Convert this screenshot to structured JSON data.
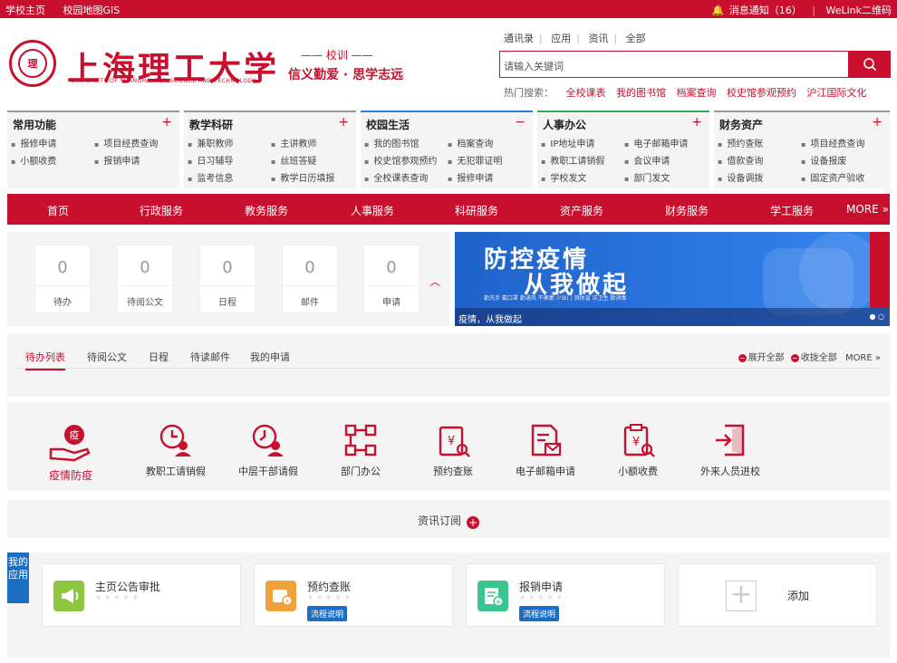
{
  "topbar": {
    "left": [
      "学校主页",
      "校园地图GIS"
    ],
    "notice": "消息通知（16）",
    "welink": "WeLink二维码"
  },
  "logo": {
    "cn": "上海理工大学",
    "en": "UNIVERSITY OF SHANGHAI FOR SCIENCE AND TECHNOLOGY"
  },
  "motto": {
    "title": "—— 校训 ——",
    "text": "信义勤爱 · 思学志远"
  },
  "top_nav": [
    "通讯录",
    "应用",
    "资讯",
    "全部"
  ],
  "search": {
    "placeholder": "请输入关键词"
  },
  "hot": {
    "label": "热门搜索：",
    "keywords": [
      "全校课表",
      "我的图书馆",
      "档案查询",
      "校史馆参观预约",
      "沪江国际文化"
    ]
  },
  "quick": [
    {
      "title": "常用功能",
      "toggle": "+",
      "color": "#999999",
      "items": [
        "报修申请",
        "项目经费查询",
        "小额收费",
        "报销申请"
      ]
    },
    {
      "title": "教学科研",
      "toggle": "+",
      "color": "#999999",
      "items": [
        "兼职教师",
        "主讲教师",
        "日习辅导",
        "丝班答疑",
        "监考信息",
        "教学日历填报"
      ]
    },
    {
      "title": "校园生活",
      "toggle": "−",
      "color": "#2a7ad6",
      "items": [
        "我的图书馆",
        "档案查询",
        "校史馆参观预约",
        "无犯罪证明",
        "全校课表查询",
        "报修申请"
      ]
    },
    {
      "title": "人事办公",
      "toggle": "+",
      "color": "#36a75a",
      "items": [
        "IP地址申请",
        "电子邮箱申请",
        "教职工请销假",
        "会议申请",
        "学校发文",
        "部门发文"
      ]
    },
    {
      "title": "财务资产",
      "toggle": "+",
      "color": "#999999",
      "items": [
        "预约查账",
        "项目经费查询",
        "借款查询",
        "设备报废",
        "设备调拨",
        "固定资产验收"
      ]
    }
  ],
  "main_nav": [
    "首页",
    "行政服务",
    "教务服务",
    "人事服务",
    "科研服务",
    "资产服务",
    "财务服务",
    "学工服务",
    "MORE »"
  ],
  "stats": [
    {
      "value": "0",
      "label": "待办"
    },
    {
      "value": "0",
      "label": "待阅公文"
    },
    {
      "value": "0",
      "label": "日程"
    },
    {
      "value": "0",
      "label": "邮件"
    },
    {
      "value": "0",
      "label": "申请"
    }
  ],
  "banner": {
    "line1": "防控疫情",
    "line2": "从我做起",
    "small": "勤洗手 戴口罩 勤通风 不聚集 少出门 测体温 讲卫生 勤消毒",
    "caption": "疫情，从我做起"
  },
  "tabs": {
    "items": [
      "待办列表",
      "待阅公文",
      "日程",
      "待读邮件",
      "我的申请"
    ],
    "expand": "展开全部",
    "collapse": "收拢全部",
    "more": "MORE »"
  },
  "apps": [
    "疫情防疫",
    "教职工请销假",
    "中层干部请假",
    "部门办公",
    "预约查账",
    "电子邮箱申请",
    "小额收费",
    "外来人员进校"
  ],
  "subscribe": {
    "label": "资讯订阅",
    "icon": "+"
  },
  "my_apps": {
    "ribbon": "我的应用",
    "cards": [
      {
        "name": "主页公告审批",
        "stars": "★★★★★",
        "badge": "",
        "color": "#8dc63f"
      },
      {
        "name": "预约查账",
        "stars": "★★★★★",
        "badge": "流程说明",
        "color": "#f0a23a"
      },
      {
        "name": "报销申请",
        "stars": "★★★★★",
        "badge": "流程说明",
        "color": "#3cc48f"
      }
    ],
    "add": "添加"
  }
}
